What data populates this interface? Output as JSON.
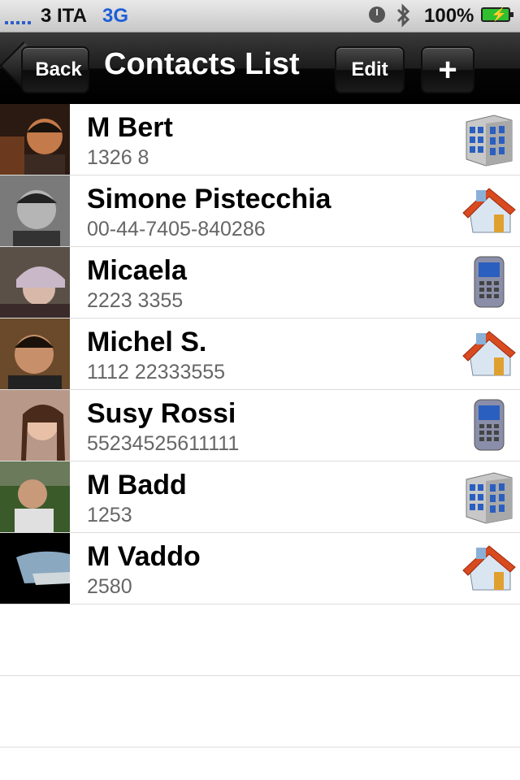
{
  "status_bar": {
    "carrier": "3 ITA",
    "network": "3G",
    "battery": "100%"
  },
  "nav_bar": {
    "back_label": "Back",
    "title": "Contacts List",
    "edit_label": "Edit",
    "add_label": "+"
  },
  "contacts": [
    {
      "name": "M Bert",
      "phone": "1326 8",
      "type_icon": "office-building-icon",
      "avatar": "photo-man-dark"
    },
    {
      "name": "Simone Pistecchia",
      "phone": "00-44-7405-840286",
      "type_icon": "home-icon",
      "avatar": "photo-man-bw"
    },
    {
      "name": "Micaela",
      "phone": "2223 3355",
      "type_icon": "mobile-phone-icon",
      "avatar": "photo-woman-hat"
    },
    {
      "name": "Michel S.",
      "phone": "1112 22333555",
      "type_icon": "home-icon",
      "avatar": "photo-man-smile"
    },
    {
      "name": "Susy Rossi",
      "phone": "55234525611111",
      "type_icon": "mobile-phone-icon",
      "avatar": "photo-woman"
    },
    {
      "name": "M Badd",
      "phone": "1253",
      "type_icon": "office-building-icon",
      "avatar": "photo-man-outdoor"
    },
    {
      "name": "M Vaddo",
      "phone": "2580",
      "type_icon": "home-icon",
      "avatar": "photo-landscape"
    }
  ],
  "colors": {
    "nav_bar": "#000000",
    "network": "#1e5fd6",
    "phone_text": "#666666"
  }
}
